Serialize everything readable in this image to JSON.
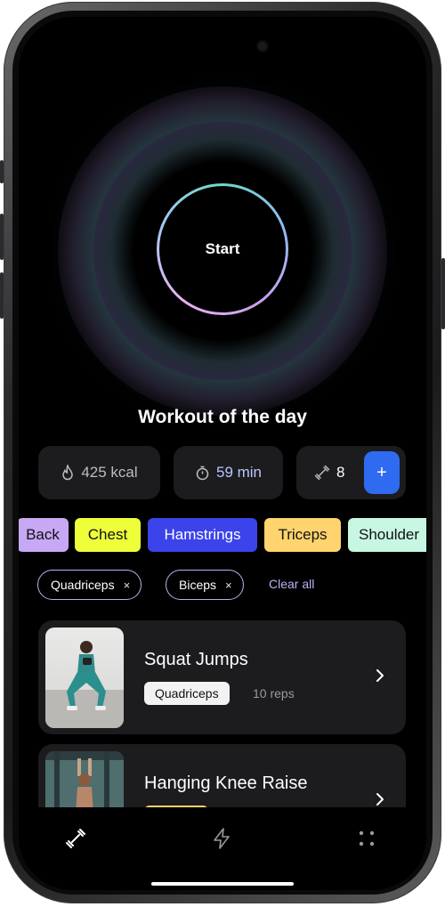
{
  "app": {
    "start_label": "Start",
    "section_title": "Workout of the day"
  },
  "stats": {
    "calories": "425 kcal",
    "duration": "59 min",
    "exercises": "8",
    "add_label": "+"
  },
  "categories": [
    {
      "label": "Back",
      "color": "#c7a8f5"
    },
    {
      "label": "Chest",
      "color": "#eeff3a"
    },
    {
      "label": "Hamstrings",
      "color": "#3b43ea"
    },
    {
      "label": "Triceps",
      "color": "#ffd36e"
    },
    {
      "label": "Shoulder",
      "color": "#c7f7e3"
    }
  ],
  "filters": {
    "active": [
      "Quadriceps",
      "Biceps"
    ],
    "clear_label": "Clear all",
    "remove_glyph": "×"
  },
  "exercises": [
    {
      "title": "Squat Jumps",
      "tag": "Quadriceps",
      "reps": "10 reps"
    },
    {
      "title": "Hanging Knee Raise",
      "tag": "",
      "reps": ""
    }
  ],
  "nav": {
    "items": [
      "dumbbell-icon",
      "lightning-icon",
      "grid-dots-icon"
    ]
  },
  "colors": {
    "accent_blue": "#2f6bf0",
    "filter_border": "#b6b2f0",
    "card_bg": "#1c1c1e"
  }
}
